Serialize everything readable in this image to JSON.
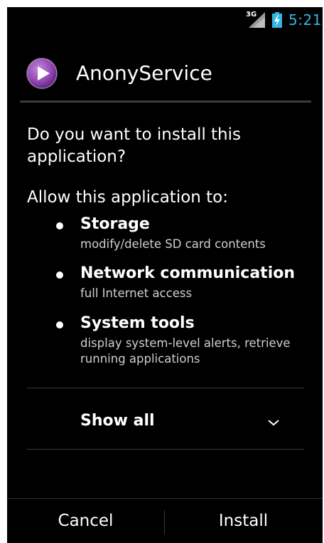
{
  "status_bar": {
    "network_type": "3G",
    "time": "5:21",
    "clock_color": "#33b5e5",
    "signal_icon": "signal-icon",
    "battery_icon": "battery-charging-icon"
  },
  "header": {
    "app_icon": "play-icon",
    "app_name": "AnonyService"
  },
  "dialog": {
    "question": "Do you want to install this application?",
    "allow_heading": "Allow this application to:",
    "permissions": [
      {
        "title": "Storage",
        "description": "modify/delete SD card contents"
      },
      {
        "title": "Network communication",
        "description": "full Internet access"
      },
      {
        "title": "System tools",
        "description": "display system-level alerts, retrieve running applications"
      }
    ],
    "show_all_label": "Show all"
  },
  "footer": {
    "cancel_label": "Cancel",
    "install_label": "Install"
  },
  "colors": {
    "background": "#000000",
    "accent": "#33b5e5",
    "app_icon": "#8e44ad"
  }
}
